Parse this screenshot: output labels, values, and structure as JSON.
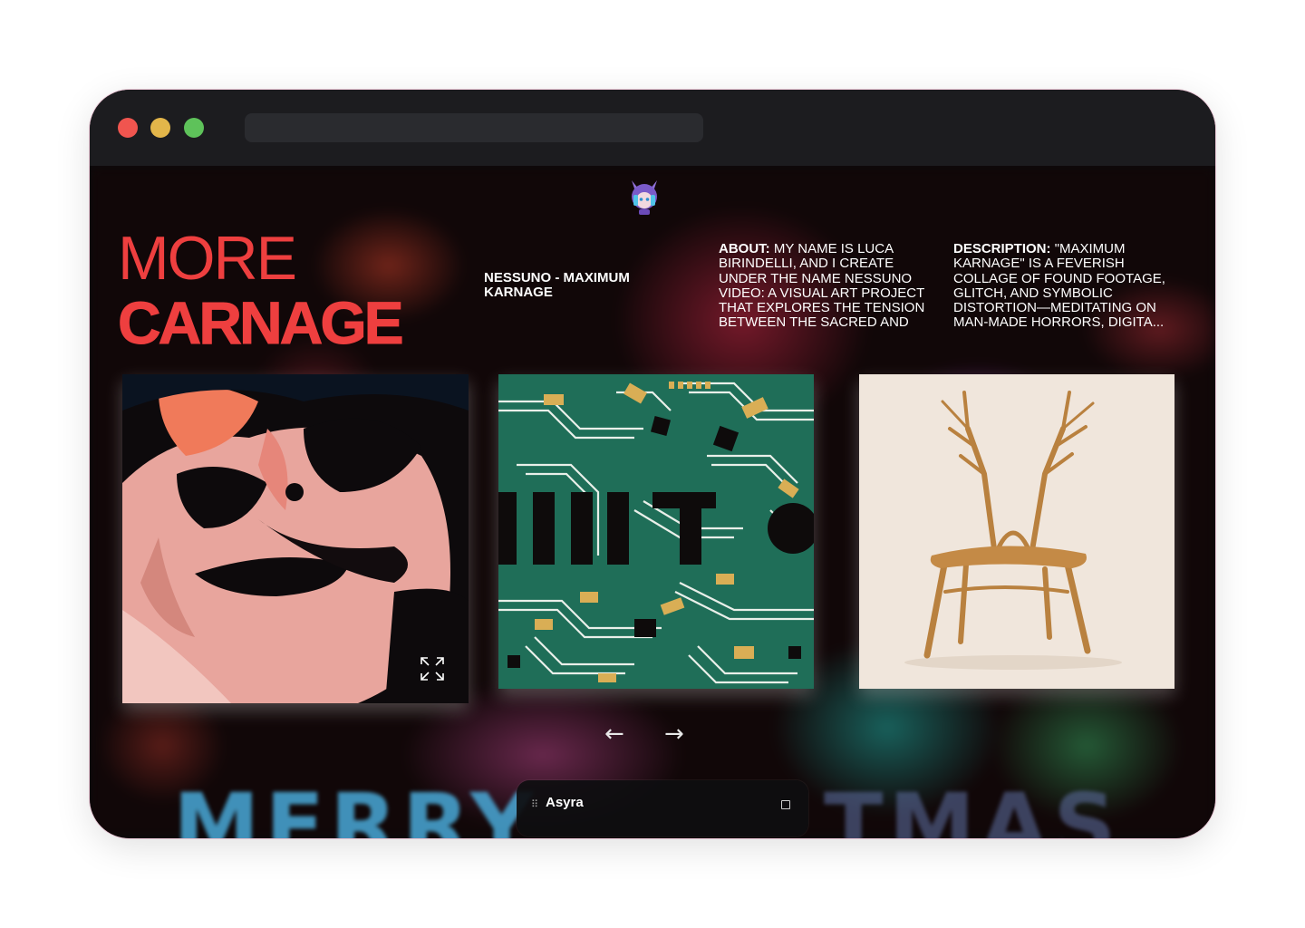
{
  "hero": {
    "line1": "MORE",
    "line2": "CARNAGE"
  },
  "track": {
    "title": "NESSUNO - MAXIMUM KARNAGE"
  },
  "about": {
    "label": "ABOUT:",
    "text": "MY NAME IS LUCA BIRINDELLI, AND I CREATE UNDER THE NAME NESSUNO VIDEO: A VISUAL ART PROJECT THAT EXPLORES THE TENSION BETWEEN THE SACRED AND TH..."
  },
  "description": {
    "label": "DESCRIPTION:",
    "text": "\"MAXIMUM KARNAGE\" IS A FEVERISH COLLAGE OF FOUND FOOTAGE, GLITCH, AND SYMBOLIC DISTORTION—MEDITATING ON MAN-MADE HORRORS, DIGITA..."
  },
  "background": {
    "text_left": "MERRY",
    "text_right": "TMAS"
  },
  "carousel": {
    "prev_icon": "←",
    "next_icon": "→"
  },
  "player": {
    "title": "Asyra",
    "handle_icon": "⠿"
  },
  "colors": {
    "accent": "#ee3f3f",
    "titlebar": "#1c1c1f",
    "background": "#0b0a0c"
  }
}
